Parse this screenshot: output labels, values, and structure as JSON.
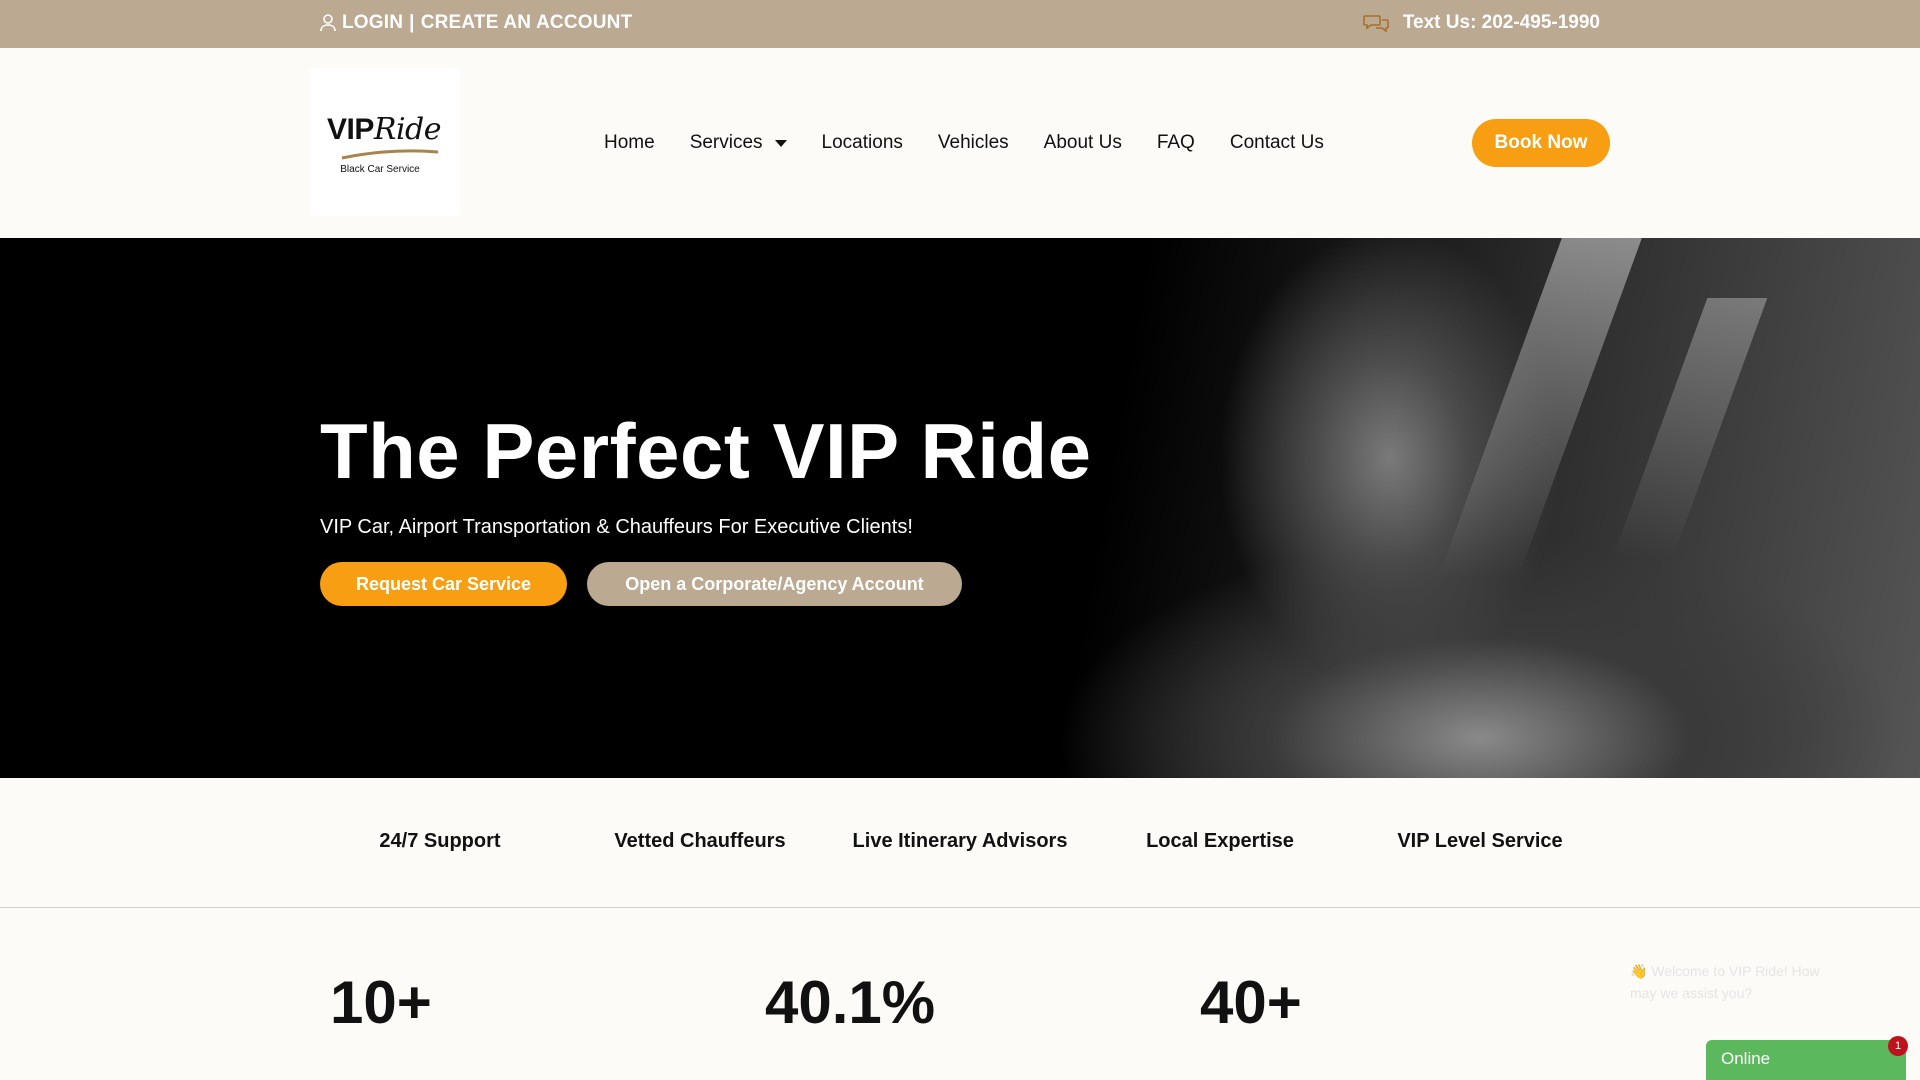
{
  "topbar": {
    "login_label": "LOGIN",
    "separator": "|",
    "create_account_label": "CREATE AN ACCOUNT",
    "text_us_label": "Text Us: 202-495-1990",
    "user_icon": "user-icon",
    "chat_icon": "chat-bubbles-icon"
  },
  "logo": {
    "brand_vip": "VIP",
    "brand_ride": "Ride",
    "tagline": "Black Car Service"
  },
  "nav": {
    "items": [
      {
        "label": "Home"
      },
      {
        "label": "Services",
        "has_dropdown": true
      },
      {
        "label": "Locations"
      },
      {
        "label": "Vehicles"
      },
      {
        "label": "About Us"
      },
      {
        "label": "FAQ"
      },
      {
        "label": "Contact Us"
      }
    ],
    "book_now_label": "Book Now"
  },
  "hero": {
    "title": "The Perfect VIP Ride",
    "subtitle": "VIP Car, Airport Transportation & Chauffeurs For Executive Clients!",
    "request_button": "Request Car Service",
    "corporate_button": "Open a Corporate/Agency Account"
  },
  "features": [
    "24/7 Support",
    "Vetted Chauffeurs",
    "Live Itinerary Advisors",
    "Local Expertise",
    "VIP Level Service"
  ],
  "stats": [
    "10+",
    "40.1%",
    "40+"
  ],
  "chat": {
    "welcome_message": "👋 Welcome to VIP Ride! How may we assist you?",
    "status_label": "Online",
    "badge_count": "1"
  },
  "colors": {
    "accent_orange": "#f79e12",
    "topbar_tan": "#bba992",
    "page_background": "#fdfbf7",
    "stat_underline": "#c79b3b",
    "online_green": "#5cb85c"
  }
}
